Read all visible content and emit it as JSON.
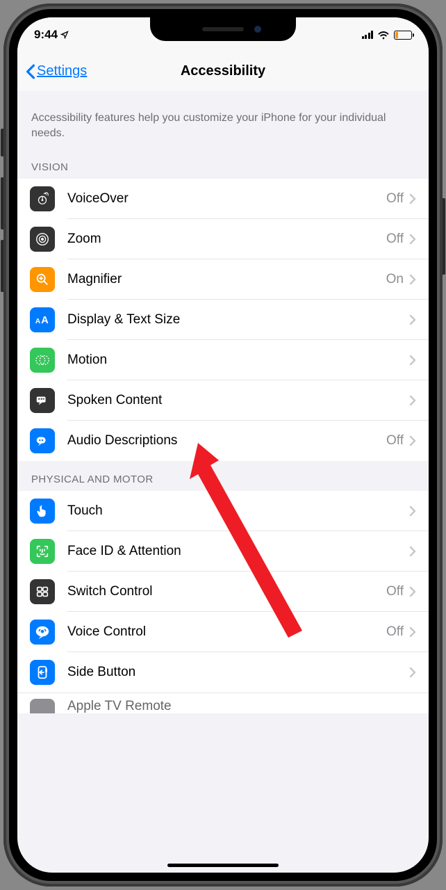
{
  "status": {
    "time": "9:44"
  },
  "nav": {
    "back_label": "Settings",
    "title": "Accessibility"
  },
  "description": "Accessibility features help you customize your iPhone for your individual needs.",
  "sections": {
    "vision": {
      "header": "VISION",
      "items": [
        {
          "label": "VoiceOver",
          "value": "Off",
          "icon": "voiceover",
          "bg": "#333333"
        },
        {
          "label": "Zoom",
          "value": "Off",
          "icon": "zoom",
          "bg": "#333333"
        },
        {
          "label": "Magnifier",
          "value": "On",
          "icon": "magnifier",
          "bg": "#ff9500"
        },
        {
          "label": "Display & Text Size",
          "value": "",
          "icon": "textsize",
          "bg": "#007aff"
        },
        {
          "label": "Motion",
          "value": "",
          "icon": "motion",
          "bg": "#34c759"
        },
        {
          "label": "Spoken Content",
          "value": "",
          "icon": "spoken",
          "bg": "#333333"
        },
        {
          "label": "Audio Descriptions",
          "value": "Off",
          "icon": "audiodesc",
          "bg": "#007aff"
        }
      ]
    },
    "physical": {
      "header": "PHYSICAL AND MOTOR",
      "items": [
        {
          "label": "Touch",
          "value": "",
          "icon": "touch",
          "bg": "#007aff"
        },
        {
          "label": "Face ID & Attention",
          "value": "",
          "icon": "faceid",
          "bg": "#34c759"
        },
        {
          "label": "Switch Control",
          "value": "Off",
          "icon": "switch",
          "bg": "#333333"
        },
        {
          "label": "Voice Control",
          "value": "Off",
          "icon": "voicectrl",
          "bg": "#007aff"
        },
        {
          "label": "Side Button",
          "value": "",
          "icon": "sidebtn",
          "bg": "#007aff"
        }
      ]
    },
    "partial": {
      "label": "Apple TV Remote"
    }
  }
}
